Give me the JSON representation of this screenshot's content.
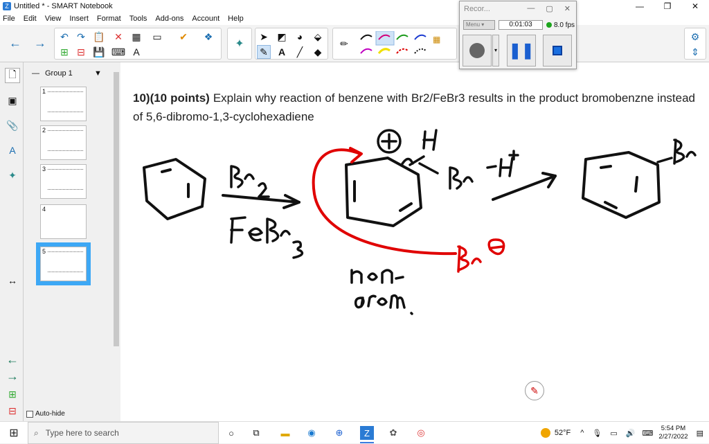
{
  "window": {
    "title": "Untitled * - SMART Notebook",
    "minimize": "—",
    "restore": "❐",
    "close": "✕"
  },
  "menu": [
    "File",
    "Edit",
    "View",
    "Insert",
    "Format",
    "Tools",
    "Add-ons",
    "Account",
    "Help"
  ],
  "sorter": {
    "group_label": "Group 1",
    "pages": [
      {
        "num": "1",
        "active": false
      },
      {
        "num": "2",
        "active": false
      },
      {
        "num": "3",
        "active": false
      },
      {
        "num": "4",
        "active": false
      },
      {
        "num": "5",
        "active": true
      }
    ],
    "autohide_label": "Auto-hide"
  },
  "question": {
    "number": "10)(10 points)",
    "text": " Explain why reaction of benzene with Br2/FeBr3 results in the product bromobenzne instead of 5,6-dibromo-1,3-cyclohexadiene"
  },
  "recorder": {
    "title": "Recor...",
    "menu_label": "Menu",
    "timer": "0:01:03",
    "fps": "8.0 fps",
    "status_color": "#1ca51c"
  },
  "taskbar": {
    "search_placeholder": "Type here to search",
    "weather": "52°F",
    "time": "5:54 PM",
    "date": "2/27/2022"
  },
  "colors": {
    "ink": "#111111",
    "red_ink": "#e00000",
    "accent": "#3da8f5"
  }
}
